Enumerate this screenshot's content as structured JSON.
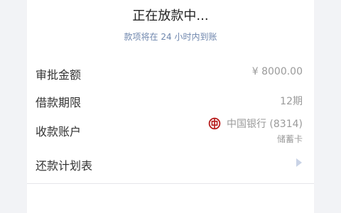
{
  "status": {
    "title": "正在放款中...",
    "subtitle": "款项将在 24 小时内到账"
  },
  "rows": {
    "amount": {
      "label": "审批金额",
      "value": "¥ 8000.00"
    },
    "term": {
      "label": "借款期限",
      "value": "12期"
    },
    "account": {
      "label": "收款账户",
      "bank": "中国银行 (8314)",
      "card_type": "储蓄卡",
      "bank_icon": "bank-of-china-logo",
      "bank_color": "#b71c1c"
    },
    "schedule": {
      "label": "还款计划表",
      "arrow_icon": "chevron-right-icon"
    }
  },
  "colors": {
    "accent_text": "#6e86ad",
    "arrow": "#c9d3e6"
  }
}
